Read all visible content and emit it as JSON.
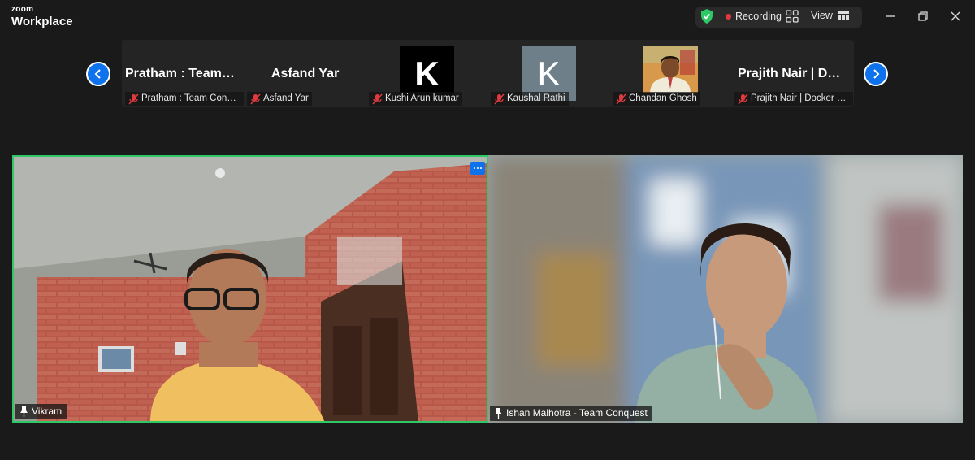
{
  "app": {
    "logo_top": "zoom",
    "logo_bottom": "Workplace"
  },
  "toolbar": {
    "shield_icon": "shield-check-icon",
    "recording_label": "Recording",
    "gallery_icon": "gallery-grid-icon",
    "view_label": "View"
  },
  "window_controls": [
    "minimize-icon",
    "restore-icon",
    "close-icon"
  ],
  "gallery": {
    "prev_icon": "chevron-left-icon",
    "next_icon": "chevron-right-icon",
    "participants": [
      {
        "display": "Pratham : Team…",
        "label": "Pratham : Team Conqu…",
        "muted": true
      },
      {
        "display": "Asfand Yar",
        "label": "Asfand Yar",
        "muted": true
      },
      {
        "display": "K",
        "label": "Kushi Arun kumar",
        "muted": true,
        "avatar_color": "#000000"
      },
      {
        "display": "K",
        "label": "Kaushal Rathi",
        "muted": true,
        "avatar_color": "#6e7f8a"
      },
      {
        "display": "",
        "label": "Chandan Ghosh",
        "muted": true
      },
      {
        "display": "Prajith Nair | D…",
        "label": "Prajith Nair | Docker V…",
        "muted": true
      }
    ]
  },
  "main": {
    "speakers": [
      {
        "name": "Vikram",
        "active": true
      },
      {
        "name": "Ishan Malhotra - Team Conquest",
        "active": false
      }
    ]
  },
  "colors": {
    "accent": "#0e72ed",
    "active_border": "#2ec866",
    "recording": "#e0393e",
    "muted": "#e0393e"
  }
}
